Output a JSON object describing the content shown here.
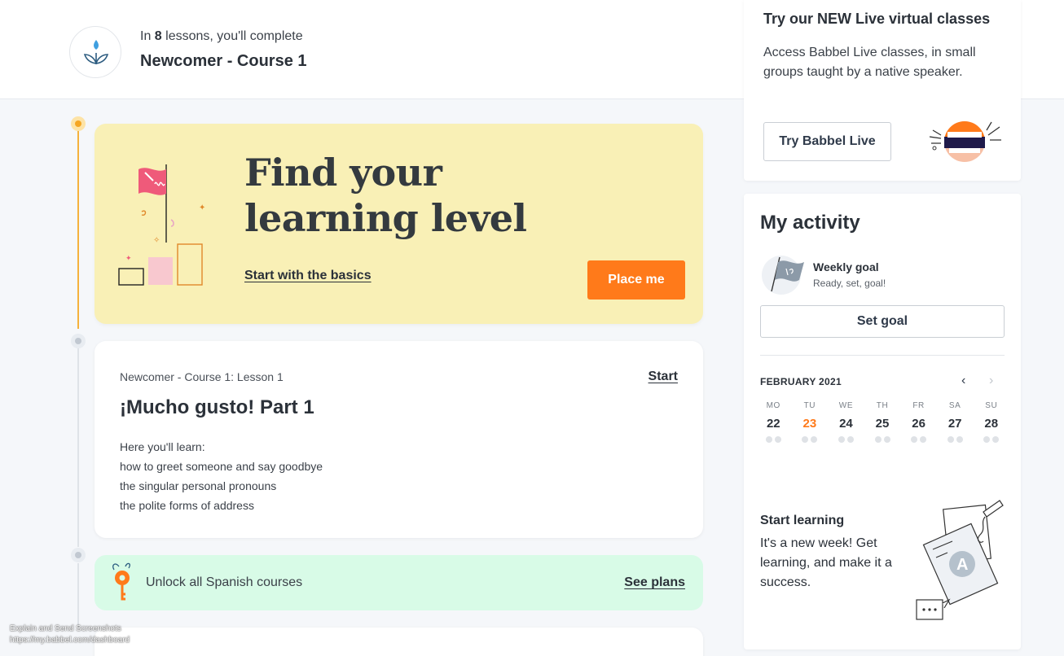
{
  "header": {
    "lessons_prefix": "In ",
    "lessons_count": "8",
    "lessons_suffix": " lessons, you'll complete",
    "course_title": "Newcomer - Course 1"
  },
  "level_card": {
    "title": "Find your learning level",
    "basics_link": "Start with the basics",
    "place_button": "Place me"
  },
  "lesson": {
    "kicker": "Newcomer - Course 1: Lesson 1",
    "start_link": "Start",
    "title": "¡Mucho gusto! Part 1",
    "learn_items": [
      "Here you'll learn:",
      "how to greet someone and say goodbye",
      "the singular personal pronouns",
      "the polite forms of address"
    ]
  },
  "unlock": {
    "text": "Unlock all Spanish courses",
    "link": "See plans"
  },
  "live": {
    "title": "Try our NEW Live virtual classes",
    "description": "Access Babbel Live classes, in small groups taught by a native speaker.",
    "button": "Try Babbel Live"
  },
  "activity": {
    "title": "My activity",
    "goal_title": "Weekly goal",
    "goal_subtitle": "Ready, set, goal!",
    "goal_button": "Set goal",
    "calendar": {
      "month": "FEBRUARY 2021",
      "prev_icon": "‹",
      "next_icon": "›",
      "days": [
        {
          "dow": "MO",
          "date": "22",
          "today": false
        },
        {
          "dow": "TU",
          "date": "23",
          "today": true
        },
        {
          "dow": "WE",
          "date": "24",
          "today": false
        },
        {
          "dow": "TH",
          "date": "25",
          "today": false
        },
        {
          "dow": "FR",
          "date": "26",
          "today": false
        },
        {
          "dow": "SA",
          "date": "27",
          "today": false
        },
        {
          "dow": "SU",
          "date": "28",
          "today": false
        }
      ]
    },
    "start_title": "Start learning",
    "start_desc": "It's a new week! Get learning, and make it a success."
  },
  "overlay": {
    "line1": "Explain and Send Screenshots",
    "line2": "https://my.babbel.com/dashboard"
  },
  "colors": {
    "accent": "#ff7a1a",
    "level_bg": "#f9f0b6",
    "unlock_bg": "#d8fbe7",
    "timeline_active": "#f5b13c"
  }
}
